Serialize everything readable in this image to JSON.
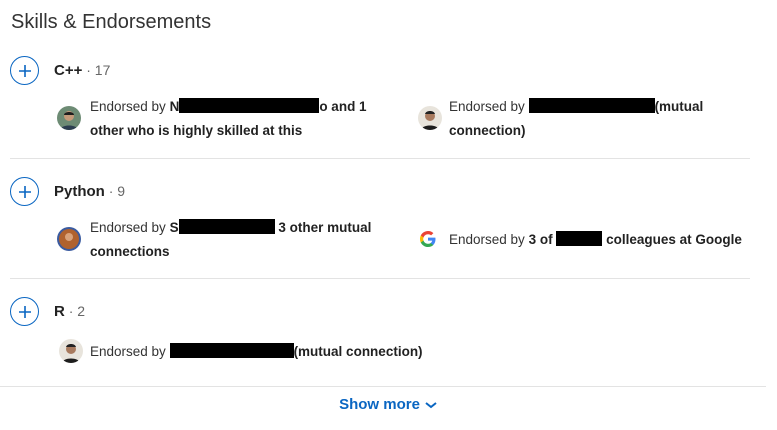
{
  "section_title": "Skills & Endorsements",
  "skills": [
    {
      "name": "C++",
      "count_text": " · 17",
      "endorsements": [
        {
          "prefix": "Endorsed by ",
          "bold1": "N",
          "bold2": "o and 1",
          "line2": "other who is highly skilled at this"
        },
        {
          "prefix": "Endorsed by ",
          "bold1": "",
          "bold2": "(mutual",
          "line2": "connection)"
        }
      ]
    },
    {
      "name": "Python",
      "count_text": " · 9",
      "endorsements": [
        {
          "prefix": "Endorsed by ",
          "bold1": "S",
          "bold2": " 3 other mutual",
          "line2": "connections"
        },
        {
          "prefix": "Endorsed by ",
          "bold1": "3 of ",
          "bold2": " colleagues at Google",
          "line2": ""
        }
      ]
    },
    {
      "name": "R",
      "count_text": " · 2",
      "endorsements": [
        {
          "prefix": "Endorsed by ",
          "bold1": "",
          "bold2": "(mutual connection)",
          "line2": ""
        }
      ]
    }
  ],
  "show_more_label": "Show more",
  "colors": {
    "accent": "#0a66c2"
  },
  "icons": {
    "plus": "plus-icon",
    "google": "google-logo-icon",
    "chevron": "chevron-down-icon"
  }
}
